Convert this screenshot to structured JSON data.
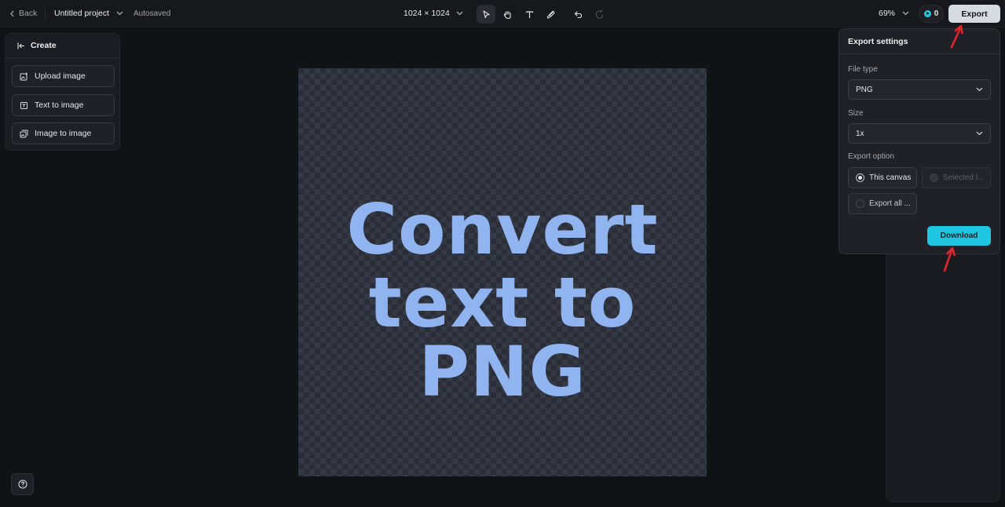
{
  "header": {
    "back_label": "Back",
    "project_name": "Untitled project",
    "save_status": "Autosaved",
    "canvas_size": "1024 × 1024",
    "zoom": "69%",
    "credits": "0",
    "export_label": "Export"
  },
  "tools": [
    "select-icon",
    "hand-icon",
    "text-icon",
    "brush-icon",
    "undo-icon",
    "redo-icon"
  ],
  "create_panel": {
    "title": "Create",
    "items": [
      {
        "label": "Upload image",
        "icon": "upload-image-icon"
      },
      {
        "label": "Text to image",
        "icon": "text-image-icon"
      },
      {
        "label": "Image to image",
        "icon": "image-image-icon"
      }
    ]
  },
  "canvas": {
    "line1": "Convert",
    "line2": "text to PNG",
    "text_color": "#8fb4f0"
  },
  "export_settings": {
    "title": "Export settings",
    "file_type_label": "File type",
    "file_type_value": "PNG",
    "size_label": "Size",
    "size_value": "1x",
    "export_option_label": "Export option",
    "options": [
      {
        "label": "This canvas",
        "selected": true,
        "disabled": false
      },
      {
        "label": "Selected l...",
        "selected": false,
        "disabled": true
      },
      {
        "label": "Export all ...",
        "selected": false,
        "disabled": false
      }
    ],
    "download_label": "Download"
  },
  "colors": {
    "accent": "#1fc6e2",
    "annotation_arrow": "#e3242b"
  }
}
